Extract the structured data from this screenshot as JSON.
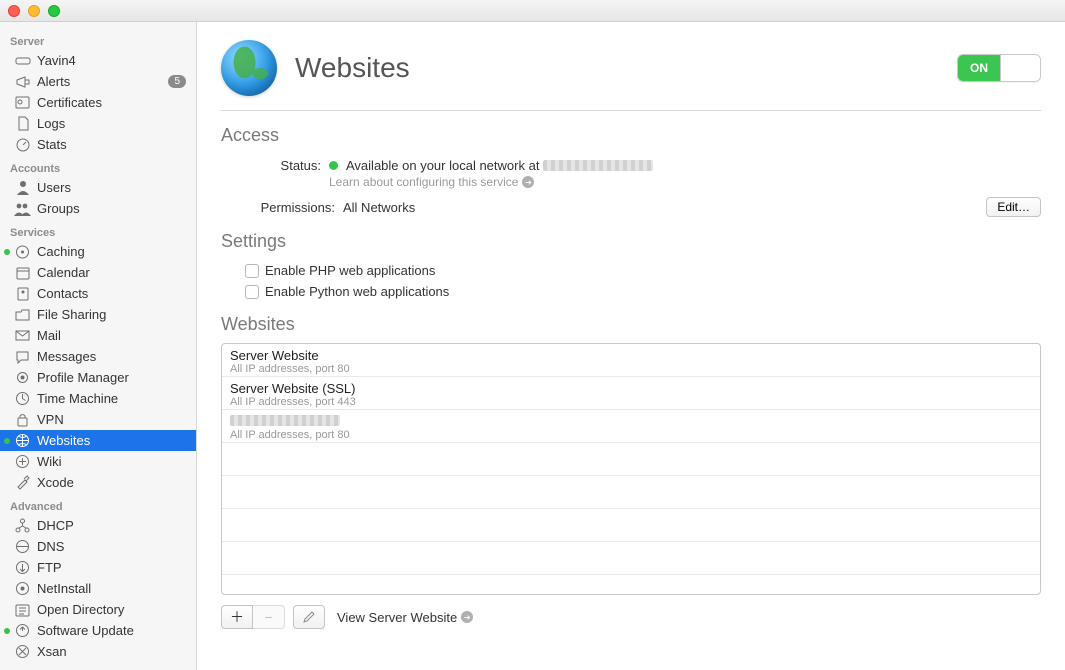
{
  "titlebar": {},
  "sidebar": {
    "sections": {
      "server": {
        "title": "Server",
        "items": [
          {
            "label": "Yavin4"
          },
          {
            "label": "Alerts",
            "badge": "5"
          },
          {
            "label": "Certificates"
          },
          {
            "label": "Logs"
          },
          {
            "label": "Stats"
          }
        ]
      },
      "accounts": {
        "title": "Accounts",
        "items": [
          {
            "label": "Users"
          },
          {
            "label": "Groups"
          }
        ]
      },
      "services": {
        "title": "Services",
        "items": [
          {
            "label": "Caching"
          },
          {
            "label": "Calendar"
          },
          {
            "label": "Contacts"
          },
          {
            "label": "File Sharing"
          },
          {
            "label": "Mail"
          },
          {
            "label": "Messages"
          },
          {
            "label": "Profile Manager"
          },
          {
            "label": "Time Machine"
          },
          {
            "label": "VPN"
          },
          {
            "label": "Websites"
          },
          {
            "label": "Wiki"
          },
          {
            "label": "Xcode"
          }
        ]
      },
      "advanced": {
        "title": "Advanced",
        "items": [
          {
            "label": "DHCP"
          },
          {
            "label": "DNS"
          },
          {
            "label": "FTP"
          },
          {
            "label": "NetInstall"
          },
          {
            "label": "Open Directory"
          },
          {
            "label": "Software Update"
          },
          {
            "label": "Xsan"
          }
        ]
      }
    }
  },
  "page": {
    "title": "Websites",
    "toggle_state": "ON",
    "sections": {
      "access": {
        "heading": "Access",
        "status_label": "Status:",
        "status_text": "Available on your local network at",
        "learn_text": "Learn about configuring this service",
        "perm_label": "Permissions:",
        "perm_value": "All Networks",
        "edit_label": "Edit…"
      },
      "settings": {
        "heading": "Settings",
        "options": [
          "Enable PHP web applications",
          "Enable Python web applications"
        ]
      },
      "websites": {
        "heading": "Websites",
        "rows": [
          {
            "name": "Server Website",
            "sub": "All IP addresses, port 80"
          },
          {
            "name": "Server Website (SSL)",
            "sub": "All IP addresses, port 443"
          },
          {
            "name": "",
            "sub": "All IP addresses, port 80"
          }
        ]
      }
    },
    "bottom": {
      "view_label": "View Server Website"
    }
  }
}
